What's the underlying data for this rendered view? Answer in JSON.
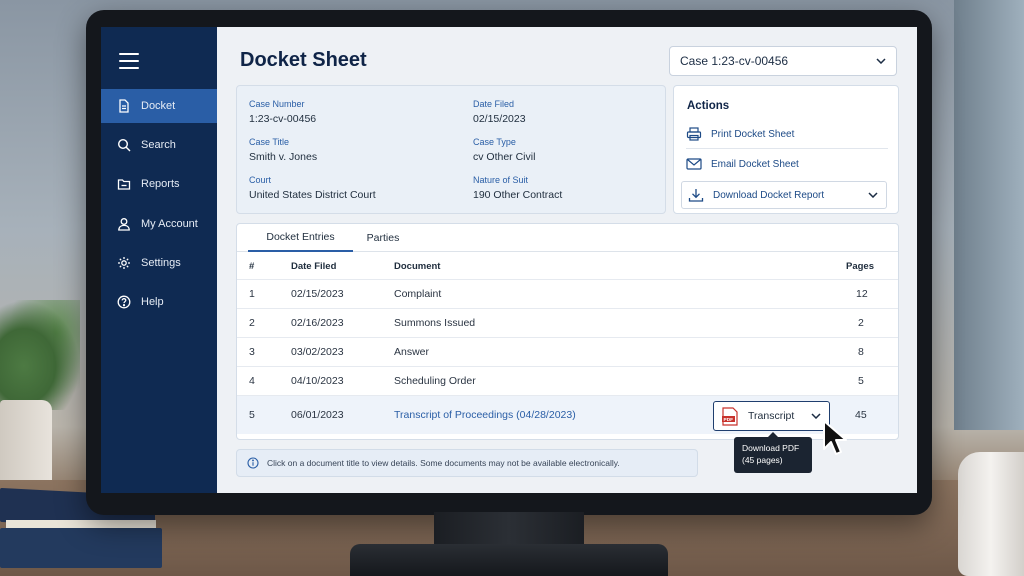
{
  "sidebar": {
    "items": [
      {
        "label": "Docket",
        "icon": "document-icon",
        "active": true
      },
      {
        "label": "Search",
        "icon": "search-icon",
        "active": false
      },
      {
        "label": "Reports",
        "icon": "folder-icon",
        "active": false
      },
      {
        "label": "My Account",
        "icon": "user-icon",
        "active": false
      },
      {
        "label": "Settings",
        "icon": "gear-icon",
        "active": false
      },
      {
        "label": "Help",
        "icon": "help-icon",
        "active": false
      }
    ]
  },
  "header": {
    "title": "Docket Sheet",
    "case_select_value": "Case 1:23-cv-00456"
  },
  "case_info": {
    "case_number_label": "Case Number",
    "case_number": "1:23-cv-00456",
    "date_filed_label": "Date Filed",
    "date_filed": "02/15/2023",
    "case_title_label": "Case Title",
    "case_title": "Smith v. Jones",
    "case_type_label": "Case Type",
    "case_type": "cv Other Civil",
    "court_label": "Court",
    "court": "United States District Court",
    "nature_label": "Nature of Suit",
    "nature": "190 Other Contract"
  },
  "actions": {
    "title": "Actions",
    "print": "Print Docket Sheet",
    "email": "Email Docket Sheet",
    "download": "Download Docket Report"
  },
  "tabs": [
    {
      "label": "Docket Entries",
      "active": true
    },
    {
      "label": "Parties",
      "active": false
    }
  ],
  "table": {
    "headers": {
      "num": "#",
      "date": "Date Filed",
      "doc": "Document",
      "pages": "Pages"
    },
    "rows": [
      {
        "num": "1",
        "date": "02/15/2023",
        "doc": "Complaint",
        "pages": "12"
      },
      {
        "num": "2",
        "date": "02/16/2023",
        "doc": "Summons Issued",
        "pages": "2"
      },
      {
        "num": "3",
        "date": "03/02/2023",
        "doc": "Answer",
        "pages": "8"
      },
      {
        "num": "4",
        "date": "04/10/2023",
        "doc": "Scheduling Order",
        "pages": "5"
      },
      {
        "num": "5",
        "date": "06/01/2023",
        "doc": "Transcript of Proceedings (04/28/2023)",
        "pages": "45"
      }
    ],
    "transcript_button": "Transcript",
    "pdf_badge": "PDF"
  },
  "tooltip": {
    "line1": "Download PDF",
    "line2": "(45 pages)"
  },
  "note": "Click on a document title to view details. Some documents may not be available electronically.",
  "colors": {
    "sidebar": "#0f2a52",
    "active_nav": "#2a5ea6",
    "link": "#2a5ea6",
    "title": "#0f2447"
  }
}
